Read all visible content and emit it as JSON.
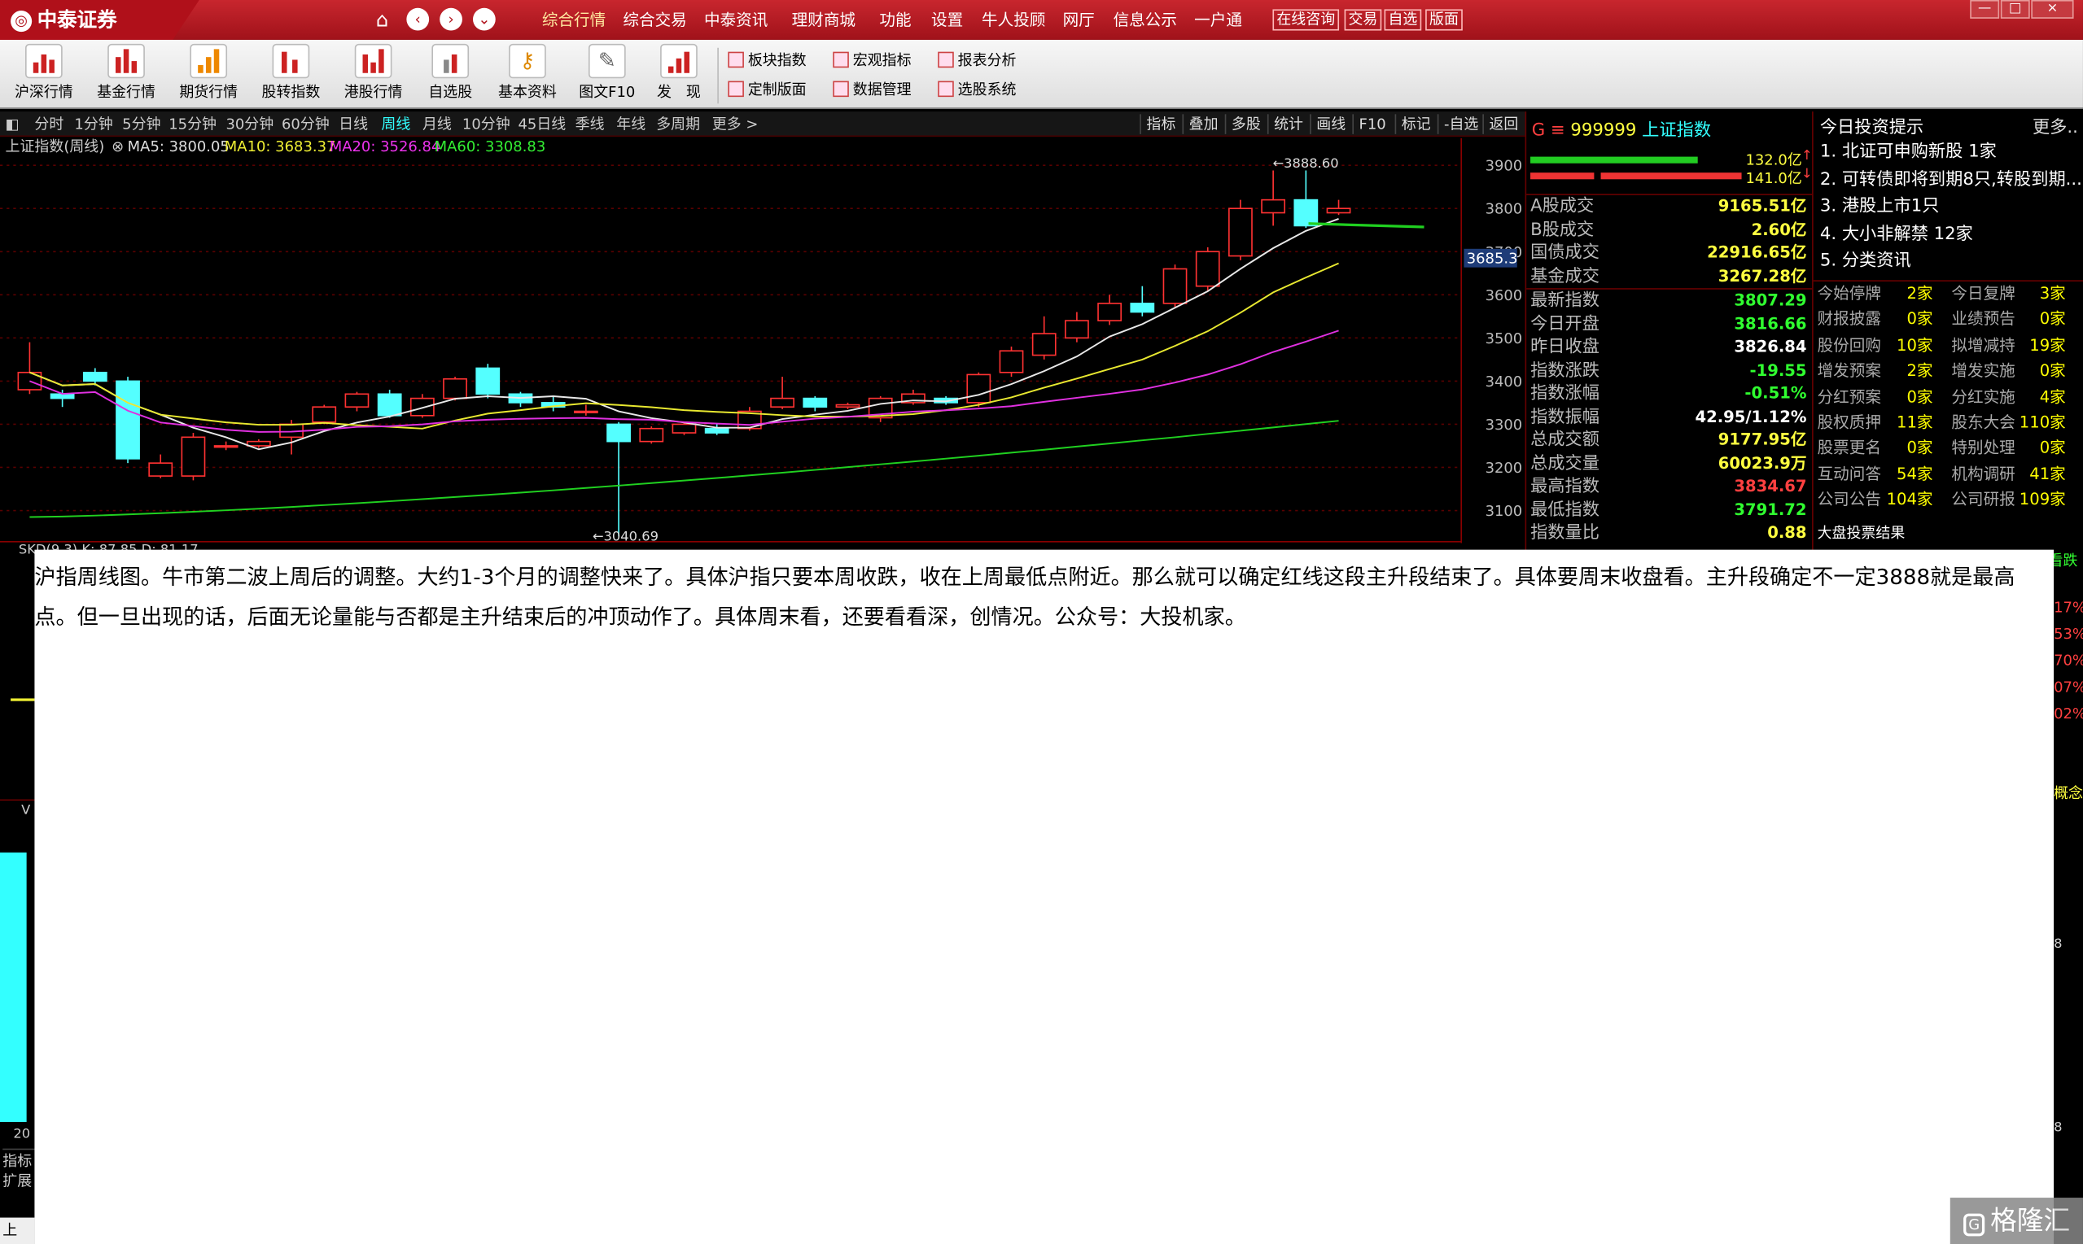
{
  "titlebar": {
    "app_name": "中泰证券",
    "menu": [
      "综合行情",
      "综合交易",
      "中泰资讯",
      "理财商城",
      "功能",
      "设置",
      "牛人投顾",
      "网厅",
      "信息公示",
      "一户通"
    ],
    "boxed": [
      "在线咨询",
      "交易",
      "自选",
      "版面"
    ],
    "window_buttons": [
      "—",
      "□",
      "×"
    ]
  },
  "toolbar": {
    "tools": [
      "沪深行情",
      "基金行情",
      "期货行情",
      "股转指数",
      "港股行情",
      "自选股",
      "基本资料",
      "图文F10",
      "发　现"
    ],
    "small_tools": [
      "板块指数",
      "宏观指标",
      "报表分析",
      "定制版面",
      "数据管理",
      "选股系统"
    ]
  },
  "periods": [
    "分时",
    "1分钟",
    "5分钟",
    "15分钟",
    "30分钟",
    "60分钟",
    "日线",
    "周线",
    "月线",
    "10分钟",
    "45日线",
    "季线",
    "年线",
    "多周期",
    "更多 >"
  ],
  "active_period": "周线",
  "right_tabs": [
    "指标",
    "叠加",
    "多股",
    "统计",
    "画线",
    "F10",
    "标记",
    "-自选",
    "返回"
  ],
  "legend": {
    "name": "上证指数(周线)",
    "ma5": "MA5: 3800.05",
    "ma10": "MA10: 3683.37",
    "ma20": "MA20: 3526.84",
    "ma60": "MA60: 3308.83"
  },
  "chart_data": {
    "type": "candlestick",
    "y_ticks": [
      3900,
      3800,
      3700,
      3600,
      3500,
      3400,
      3300,
      3200,
      3100
    ],
    "ylim": [
      3040,
      3920
    ],
    "current_price_tag": "3685.3",
    "annotations": {
      "high": "3888.60",
      "low": "3040.69"
    },
    "candles": [
      [
        3380,
        3420,
        3370,
        3490
      ],
      [
        3370,
        3360,
        3340,
        3380
      ],
      [
        3420,
        3400,
        3390,
        3430
      ],
      [
        3400,
        3220,
        3210,
        3410
      ],
      [
        3180,
        3210,
        3175,
        3230
      ],
      [
        3180,
        3270,
        3170,
        3280
      ],
      [
        3250,
        3250,
        3240,
        3260
      ],
      [
        3250,
        3260,
        3245,
        3265
      ],
      [
        3270,
        3300,
        3230,
        3310
      ],
      [
        3305,
        3340,
        3300,
        3345
      ],
      [
        3340,
        3370,
        3330,
        3375
      ],
      [
        3370,
        3320,
        3315,
        3380
      ],
      [
        3320,
        3360,
        3315,
        3370
      ],
      [
        3360,
        3405,
        3355,
        3410
      ],
      [
        3430,
        3370,
        3360,
        3440
      ],
      [
        3370,
        3350,
        3340,
        3375
      ],
      [
        3350,
        3340,
        3330,
        3365
      ],
      [
        3330,
        3330,
        3320,
        3345
      ],
      [
        3300,
        3260,
        3040,
        3305
      ],
      [
        3260,
        3290,
        3255,
        3295
      ],
      [
        3280,
        3300,
        3275,
        3305
      ],
      [
        3290,
        3280,
        3275,
        3300
      ],
      [
        3290,
        3330,
        3285,
        3340
      ],
      [
        3340,
        3360,
        3335,
        3410
      ],
      [
        3360,
        3340,
        3330,
        3365
      ],
      [
        3340,
        3345,
        3335,
        3350
      ],
      [
        3315,
        3360,
        3305,
        3365
      ],
      [
        3350,
        3370,
        3345,
        3380
      ],
      [
        3360,
        3350,
        3345,
        3365
      ],
      [
        3350,
        3415,
        3340,
        3420
      ],
      [
        3420,
        3470,
        3410,
        3480
      ],
      [
        3460,
        3510,
        3450,
        3550
      ],
      [
        3500,
        3540,
        3490,
        3560
      ],
      [
        3540,
        3580,
        3530,
        3600
      ],
      [
        3580,
        3560,
        3550,
        3620
      ],
      [
        3580,
        3660,
        3570,
        3670
      ],
      [
        3620,
        3700,
        3610,
        3710
      ],
      [
        3690,
        3800,
        3680,
        3820
      ],
      [
        3790,
        3820,
        3760,
        3888
      ],
      [
        3820,
        3760,
        3755,
        3888
      ],
      [
        3790,
        3800,
        3785,
        3820
      ]
    ]
  },
  "quote": {
    "code": "999999",
    "name": "上证指数",
    "bar_top_value": "132.0亿",
    "bar_bottom_value": "141.0亿",
    "vol_rows": [
      {
        "label": "A股成交",
        "value": "9165.51亿"
      },
      {
        "label": "B股成交",
        "value": "2.60亿"
      },
      {
        "label": "国债成交",
        "value": "22916.65亿"
      },
      {
        "label": "基金成交",
        "value": "3267.28亿"
      }
    ],
    "rows": [
      {
        "label": "最新指数",
        "value": "3807.29",
        "cls": "green"
      },
      {
        "label": "今日开盘",
        "value": "3816.66",
        "cls": "green"
      },
      {
        "label": "昨日收盘",
        "value": "3826.84",
        "cls": "white"
      },
      {
        "label": "指数涨跌",
        "value": "-19.55",
        "cls": "green"
      },
      {
        "label": "指数涨幅",
        "value": "-0.51%",
        "cls": "green"
      },
      {
        "label": "指数振幅",
        "value": "42.95/1.12%",
        "cls": "white"
      },
      {
        "label": "总成交额",
        "value": "9177.95亿",
        "cls": "yellow"
      },
      {
        "label": "总成交量",
        "value": "60023.9万",
        "cls": "yellow"
      },
      {
        "label": "最高指数",
        "value": "3834.67",
        "cls": "red"
      },
      {
        "label": "最低指数",
        "value": "3791.72",
        "cls": "green"
      },
      {
        "label": "指数量比",
        "value": "0.88",
        "cls": "yellow"
      }
    ]
  },
  "tips": {
    "title": "今日投资提示",
    "more": "更多..",
    "items": [
      "1. 北证可申购新股 1家",
      "2. 可转债即将到期8只,转股到期...",
      "3. 港股上市1只",
      "4. 大小非解禁 12家",
      "5. 分类资讯"
    ],
    "grid": [
      [
        "今始停牌",
        "2家",
        "今日复牌",
        "3家"
      ],
      [
        "财报披露",
        "0家",
        "业绩预告",
        "0家"
      ],
      [
        "股份回购",
        "10家",
        "拟增减持",
        "19家"
      ],
      [
        "增发预案",
        "2家",
        "增发实施",
        "0家"
      ],
      [
        "分红预案",
        "0家",
        "分红实施",
        "4家"
      ],
      [
        "股权质押",
        "11家",
        "股东大会",
        "110家"
      ],
      [
        "股票更名",
        "0家",
        "特别处理",
        "0家"
      ],
      [
        "互动问答",
        "54家",
        "机构调研",
        "41家"
      ],
      [
        "公司公告",
        "104家",
        "公司研报",
        "109家"
      ]
    ],
    "footer": "大盘投票结果"
  },
  "overlay_text": "沪指周线图。牛市第二波上周后的调整。大约1-3个月的调整快来了。具体沪指只要本周收跌，收在上周最低点附近。那么就可以确定红线这段主升段结束了。具体要周末收盘看。主升段确定不一定3888就是最高点。但一旦出现的话，后面无论量能与否都是主升结束后的冲顶动作了。具体周末看，还要看看深，创情况。公众号：大投机家。",
  "left_fragments": {
    "skd": "SKD(9,3) K: 87.85 D: 81.17",
    "vol": "V",
    "year": "20",
    "tab1": "指标",
    "tab2": "扩展",
    "bottom": "上"
  },
  "right_fragments": {
    "label_top": "看跌",
    "pcts": [
      "17%",
      "53%",
      "70%",
      "07%",
      "02%"
    ],
    "concept": "概念",
    "n1": "8",
    "n2": "8"
  },
  "watermark": "格隆汇"
}
